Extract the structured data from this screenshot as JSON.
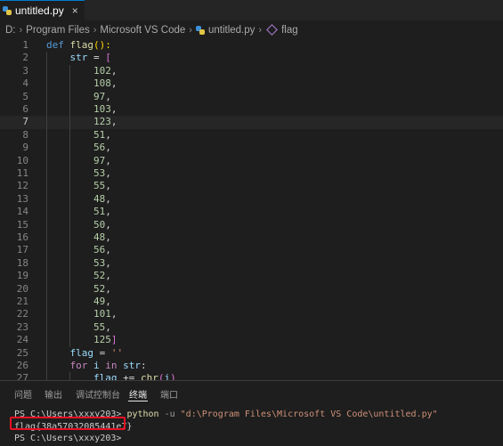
{
  "tab": {
    "label": "untitled.py",
    "close": "×"
  },
  "breadcrumb": [
    "D:",
    "Program Files",
    "Microsoft VS Code",
    "untitled.py",
    "flag"
  ],
  "editor": {
    "current_line": 7,
    "lines": [
      {
        "n": "1",
        "tokens": [
          [
            "kw",
            "def "
          ],
          [
            "fn",
            "flag"
          ],
          [
            "br1",
            "():"
          ]
        ]
      },
      {
        "n": "2",
        "indent": 1,
        "tokens": [
          [
            "var",
            "str"
          ],
          [
            "op",
            " = "
          ],
          [
            "br2",
            "["
          ]
        ]
      },
      {
        "n": "3",
        "indent": 2,
        "tokens": [
          [
            "num",
            "102"
          ],
          [
            "op",
            ","
          ]
        ]
      },
      {
        "n": "4",
        "indent": 2,
        "tokens": [
          [
            "num",
            "108"
          ],
          [
            "op",
            ","
          ]
        ]
      },
      {
        "n": "5",
        "indent": 2,
        "tokens": [
          [
            "num",
            "97"
          ],
          [
            "op",
            ","
          ]
        ]
      },
      {
        "n": "6",
        "indent": 2,
        "tokens": [
          [
            "num",
            "103"
          ],
          [
            "op",
            ","
          ]
        ]
      },
      {
        "n": "7",
        "indent": 2,
        "tokens": [
          [
            "num",
            "123"
          ],
          [
            "op",
            ","
          ]
        ]
      },
      {
        "n": "8",
        "indent": 2,
        "tokens": [
          [
            "num",
            "51"
          ],
          [
            "op",
            ","
          ]
        ]
      },
      {
        "n": "9",
        "indent": 2,
        "tokens": [
          [
            "num",
            "56"
          ],
          [
            "op",
            ","
          ]
        ]
      },
      {
        "n": "10",
        "indent": 2,
        "tokens": [
          [
            "num",
            "97"
          ],
          [
            "op",
            ","
          ]
        ]
      },
      {
        "n": "11",
        "indent": 2,
        "tokens": [
          [
            "num",
            "53"
          ],
          [
            "op",
            ","
          ]
        ]
      },
      {
        "n": "12",
        "indent": 2,
        "tokens": [
          [
            "num",
            "55"
          ],
          [
            "op",
            ","
          ]
        ]
      },
      {
        "n": "13",
        "indent": 2,
        "tokens": [
          [
            "num",
            "48"
          ],
          [
            "op",
            ","
          ]
        ]
      },
      {
        "n": "14",
        "indent": 2,
        "tokens": [
          [
            "num",
            "51"
          ],
          [
            "op",
            ","
          ]
        ]
      },
      {
        "n": "15",
        "indent": 2,
        "tokens": [
          [
            "num",
            "50"
          ],
          [
            "op",
            ","
          ]
        ]
      },
      {
        "n": "16",
        "indent": 2,
        "tokens": [
          [
            "num",
            "48"
          ],
          [
            "op",
            ","
          ]
        ]
      },
      {
        "n": "17",
        "indent": 2,
        "tokens": [
          [
            "num",
            "56"
          ],
          [
            "op",
            ","
          ]
        ]
      },
      {
        "n": "18",
        "indent": 2,
        "tokens": [
          [
            "num",
            "53"
          ],
          [
            "op",
            ","
          ]
        ]
      },
      {
        "n": "19",
        "indent": 2,
        "tokens": [
          [
            "num",
            "52"
          ],
          [
            "op",
            ","
          ]
        ]
      },
      {
        "n": "20",
        "indent": 2,
        "tokens": [
          [
            "num",
            "52"
          ],
          [
            "op",
            ","
          ]
        ]
      },
      {
        "n": "21",
        "indent": 2,
        "tokens": [
          [
            "num",
            "49"
          ],
          [
            "op",
            ","
          ]
        ]
      },
      {
        "n": "22",
        "indent": 2,
        "tokens": [
          [
            "num",
            "101"
          ],
          [
            "op",
            ","
          ]
        ]
      },
      {
        "n": "23",
        "indent": 2,
        "tokens": [
          [
            "num",
            "55"
          ],
          [
            "op",
            ","
          ]
        ]
      },
      {
        "n": "24",
        "indent": 2,
        "tokens": [
          [
            "num",
            "125"
          ],
          [
            "br2",
            "]"
          ]
        ]
      },
      {
        "n": "25",
        "indent": 1,
        "tokens": [
          [
            "var",
            "flag"
          ],
          [
            "op",
            " = "
          ],
          [
            "str",
            "''"
          ]
        ]
      },
      {
        "n": "26",
        "indent": 1,
        "tokens": [
          [
            "kw2",
            "for "
          ],
          [
            "var",
            "i"
          ],
          [
            "kw2",
            " in "
          ],
          [
            "var",
            "str"
          ],
          [
            "op",
            ":"
          ]
        ]
      },
      {
        "n": "27",
        "indent": 2,
        "tokens": [
          [
            "var",
            "flag"
          ],
          [
            "op",
            " += "
          ],
          [
            "fn",
            "chr"
          ],
          [
            "br2",
            "("
          ],
          [
            "var",
            "i"
          ],
          [
            "br2",
            ")"
          ]
        ]
      }
    ]
  },
  "panel": {
    "tabs": [
      "问题",
      "输出",
      "调试控制台",
      "终端",
      "端口"
    ],
    "active_tab": 3,
    "terminal": {
      "prompt1": "PS C:\\Users\\xxxy203> ",
      "cmd": "python",
      "flag": " -u ",
      "path": "\"d:\\Program Files\\Microsoft VS Code\\untitled.py\"",
      "output": "flag{38a57032085441e7}",
      "prompt2": "PS C:\\Users\\xxxy203>"
    }
  },
  "colors": {
    "keyword": "#569cd6",
    "function": "#dcdcaa",
    "number": "#b5cea8",
    "string": "#ce9178",
    "highlight_box": "#e81123"
  }
}
